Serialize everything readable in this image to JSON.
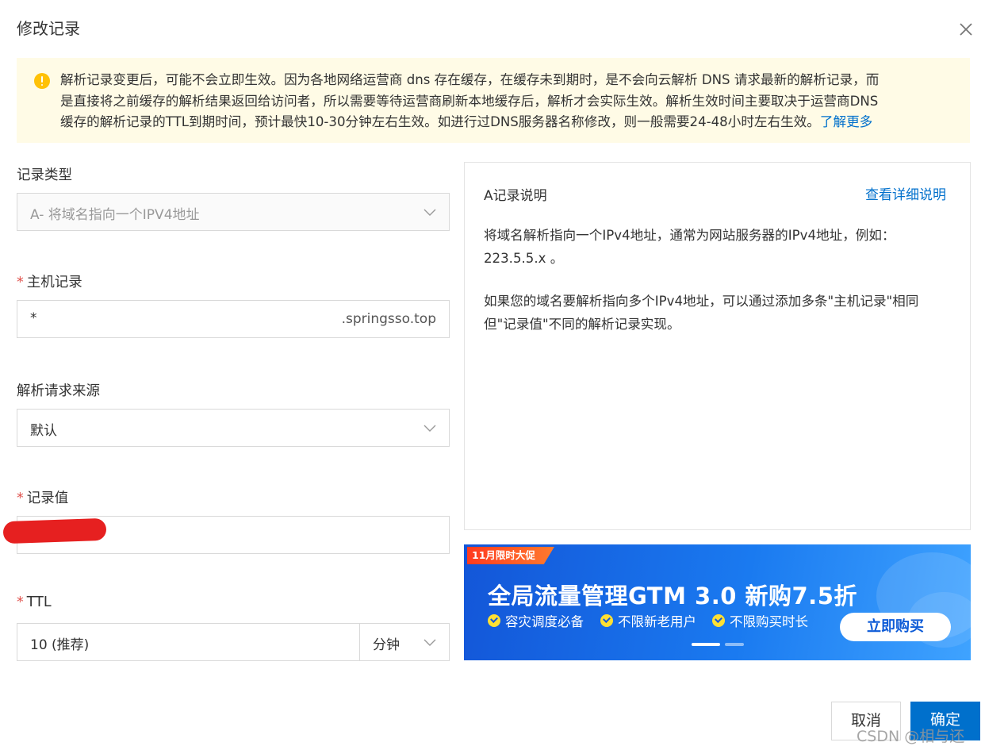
{
  "dialog": {
    "title": "修改记录"
  },
  "alert": {
    "lines": [
      "解析记录变更后，可能不会立即生效。因为各地网络运营商 dns 存在缓存，在缓存未到期时，是不会向云解析 DNS 请求最新的解析记录，而",
      "是直接将之前缓存的解析结果返回给访问者，所以需要等待运营商刷新本地缓存后，解析才会实际生效。解析生效时间主要取决于运营商DNS",
      "缓存的解析记录的TTL到期时间，预计最快10-30分钟左右生效。如进行过DNS服务器名称修改，则一般需要24-48小时左右生效。"
    ],
    "link": "了解更多",
    "icon": "warning-icon",
    "color": "#ffc107"
  },
  "form": {
    "record_type": {
      "label": "记录类型",
      "value": "A- 将域名指向一个IPV4地址"
    },
    "host": {
      "label": "主机记录",
      "value": "*",
      "suffix": ".springsso.top"
    },
    "source": {
      "label": "解析请求来源",
      "value": "默认"
    },
    "record_value": {
      "label": "记录值",
      "value": ""
    },
    "ttl": {
      "label": "TTL",
      "value": "10 (推荐)",
      "unit": "分钟"
    },
    "required_mark": "*"
  },
  "panel": {
    "title": "A记录说明",
    "link": "查看详细说明",
    "p1": [
      "将域名解析指向一个IPv4地址，通常为网站服务器的IPv4地址，例如：",
      "223.5.5.x 。"
    ],
    "p2": [
      "如果您的域名要解析指向多个IPv4地址，可以通过添加多条\"主机记录\"相同",
      "但\"记录值\"不同的解析记录实现。"
    ]
  },
  "banner": {
    "tag": "11月限时大促",
    "title": "全局流量管理GTM 3.0 新购7.5折",
    "features": [
      "容灾调度必备",
      "不限新老用户",
      "不限购买时长"
    ],
    "cta": "立即购买"
  },
  "footer": {
    "cancel": "取消",
    "ok": "确定",
    "watermark": "CSDN @相与还"
  },
  "colors": {
    "primary": "#0070cc",
    "required": "#e0534e",
    "alert_bg": "#fffbe6"
  }
}
